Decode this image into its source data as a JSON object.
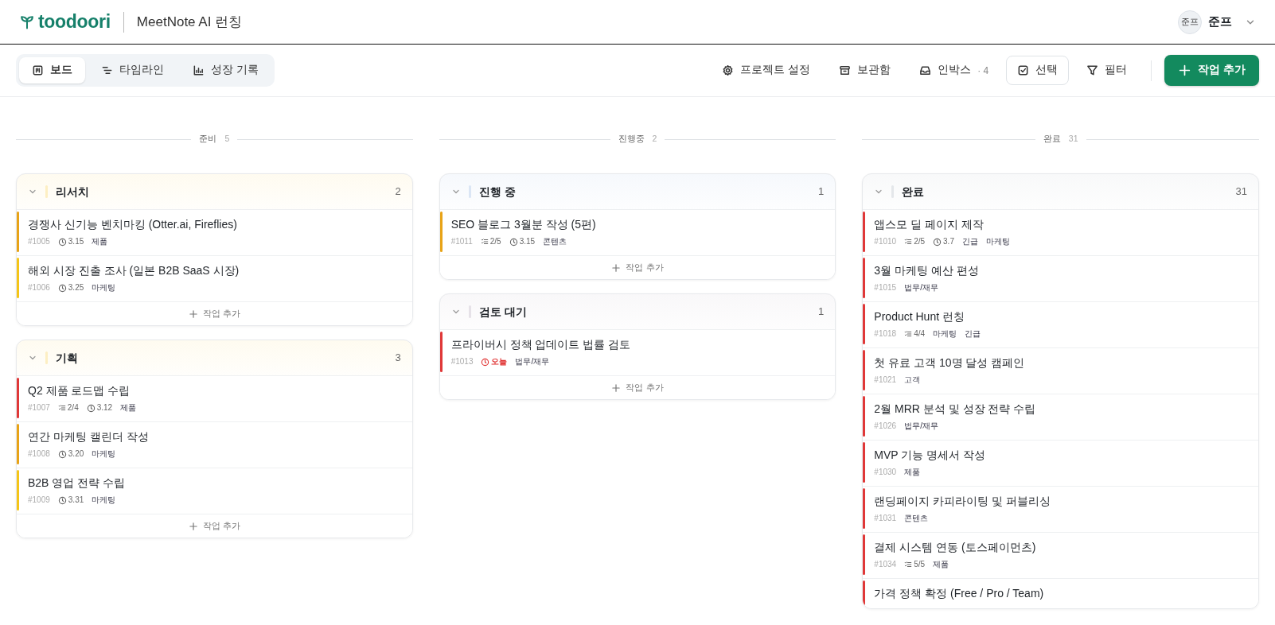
{
  "app": {
    "logo": "toodoori",
    "project": "MeetNote AI 런칭"
  },
  "user": {
    "avatar": "준프",
    "name": "준프"
  },
  "views": [
    {
      "kind": "board",
      "label": "보드",
      "selected": true
    },
    {
      "kind": "timeline",
      "label": "타임라인",
      "selected": false
    },
    {
      "kind": "growth",
      "label": "성장 기록",
      "selected": false
    }
  ],
  "actions": [
    {
      "kind": "settings",
      "label": "프로젝트 설정"
    },
    {
      "kind": "archive",
      "label": "보관함"
    },
    {
      "kind": "inbox",
      "label": "인박스",
      "count": "· 4"
    },
    {
      "kind": "select",
      "label": "선택"
    },
    {
      "kind": "filter",
      "label": "필터"
    },
    {
      "kind": "add",
      "label": "작업 추가"
    }
  ],
  "columns": [
    {
      "title": "준비",
      "count": "5",
      "groups": [
        {
          "title": "리서치",
          "count": "2",
          "color": "#fdefc3",
          "add_label": "작업 추가",
          "cards": [
            {
              "title": "경쟁사 신기능 벤치마킹 (Otter.ai, Fireflies)",
              "color": "#e8a317",
              "id": "#1005",
              "due": "3.15",
              "overdue": false,
              "tags": [
                "제품"
              ]
            },
            {
              "title": "해외 시장 진출 조사 (일본 B2B SaaS 시장)",
              "color": "#f5c518",
              "id": "#1006",
              "due": "3.25",
              "overdue": false,
              "tags": [
                "마케팅"
              ]
            }
          ]
        },
        {
          "title": "기획",
          "count": "3",
          "color": "#fdefc3",
          "add_label": "작업 추가",
          "cards": [
            {
              "title": "Q2 제품 로드맵 수립",
              "color": "#e03838",
              "id": "#1007",
              "subtasks": "2/4",
              "due": "3.12",
              "overdue": false,
              "tags": [
                "제품"
              ]
            },
            {
              "title": "연간 마케팅 캘린더 작성",
              "color": "#e8a317",
              "id": "#1008",
              "due": "3.20",
              "overdue": false,
              "tags": [
                "마케팅"
              ]
            },
            {
              "title": "B2B 영업 전략 수립",
              "color": "#f5c518",
              "id": "#1009",
              "due": "3.31",
              "overdue": false,
              "tags": [
                "마케팅"
              ]
            }
          ]
        }
      ]
    },
    {
      "title": "진행중",
      "count": "2",
      "groups": [
        {
          "title": "진행 중",
          "count": "1",
          "color": "#dbe6f5",
          "add_label": "작업 추가",
          "cards": [
            {
              "title": "SEO 블로그 3월분 작성 (5편)",
              "color": "#e8a317",
              "id": "#1011",
              "subtasks": "2/5",
              "due": "3.15",
              "overdue": false,
              "tags": [
                "콘텐츠"
              ]
            }
          ]
        },
        {
          "title": "검토 대기",
          "count": "1",
          "color": "#e6e2e8",
          "add_label": "작업 추가",
          "cards": [
            {
              "title": "프라이버시 정책 업데이트 법률 검토",
              "color": "#e03838",
              "id": "#1013",
              "due": "오늘",
              "overdue": true,
              "tags": [
                "법무/재무"
              ]
            }
          ]
        }
      ]
    },
    {
      "title": "완료",
      "count": "31",
      "groups": [
        {
          "title": "완료",
          "count": "31",
          "color": "#e4e7ea",
          "cards": [
            {
              "title": "앱스모 딜 페이지 제작",
              "color": "#e03838",
              "id": "#1010",
              "subtasks": "2/5",
              "due": "3.7",
              "overdue": false,
              "tags": [
                "긴급",
                "마케팅"
              ]
            },
            {
              "title": "3월 마케팅 예산 편성",
              "color": "#e03838",
              "id": "#1015",
              "tags": [
                "법무/재무"
              ]
            },
            {
              "title": "Product Hunt 런칭",
              "color": "#e03838",
              "id": "#1018",
              "subtasks": "4/4",
              "tags": [
                "마케팅",
                "긴급"
              ]
            },
            {
              "title": "첫 유료 고객 10명 달성 캠페인",
              "color": "#e03838",
              "id": "#1021",
              "tags": [
                "고객"
              ]
            },
            {
              "title": "2월 MRR 분석 및 성장 전략 수립",
              "color": "#e03838",
              "id": "#1026",
              "tags": [
                "법무/재무"
              ]
            },
            {
              "title": "MVP 기능 명세서 작성",
              "color": "#e03838",
              "id": "#1030",
              "tags": [
                "제품"
              ]
            },
            {
              "title": "랜딩페이지 카피라이팅 및 퍼블리싱",
              "color": "#e03838",
              "id": "#1031",
              "tags": [
                "콘텐츠"
              ]
            },
            {
              "title": "결제 시스템 연동 (토스페이먼츠)",
              "color": "#e03838",
              "id": "#1034",
              "subtasks": "5/5",
              "tags": [
                "제품"
              ]
            },
            {
              "title": "가격 정책 확정 (Free / Pro / Team)",
              "color": "#e03838"
            }
          ]
        }
      ]
    }
  ]
}
